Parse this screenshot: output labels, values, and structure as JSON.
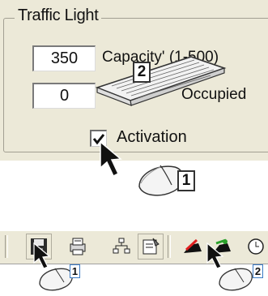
{
  "group": {
    "title": "Traffic Light"
  },
  "fields": [
    {
      "value": "350",
      "label": "Capacity' (1-500)"
    },
    {
      "value": "0",
      "label": "Occupied"
    }
  ],
  "activation": {
    "label": "Activation",
    "checked": true
  },
  "callouts": {
    "keyboard": "2",
    "mouse_top": "1",
    "mouse_save": "1",
    "mouse_car": "2"
  },
  "toolbar": {
    "buttons": [
      "save-icon",
      "print-icon",
      "network-icon",
      "properties-icon",
      "red-car-icon",
      "green-car-icon",
      "clock-icon"
    ]
  },
  "colors": {
    "panel": "#ece9d8",
    "callout_border": "#3a7bc4"
  }
}
